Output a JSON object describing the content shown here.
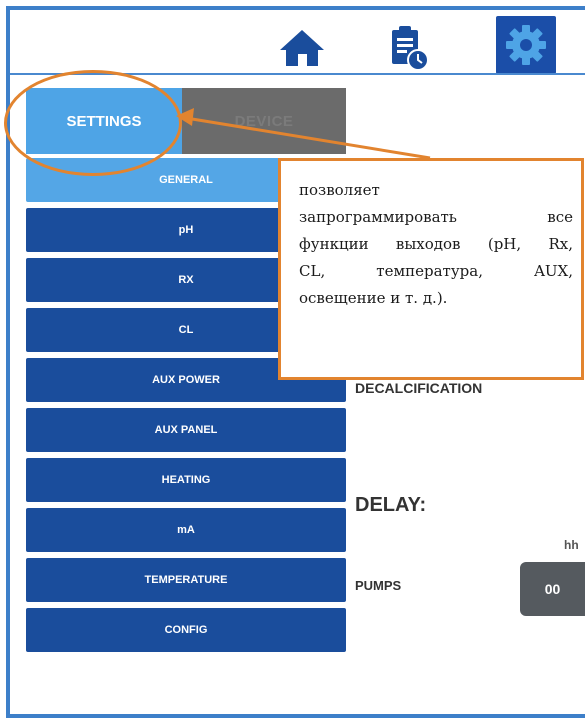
{
  "toolbar": {
    "home_icon": "home-icon",
    "report_icon": "clipboard-clock-icon",
    "settings_icon": "gear-icon"
  },
  "tabs": [
    {
      "label": "SETTINGS",
      "active": true
    },
    {
      "label": "DEVICE",
      "active": false
    }
  ],
  "menu": {
    "items": [
      {
        "label": "GENERAL",
        "active": true
      },
      {
        "label": "pH",
        "active": false
      },
      {
        "label": "RX",
        "active": false
      },
      {
        "label": "CL",
        "active": false
      },
      {
        "label": "AUX POWER",
        "active": false
      },
      {
        "label": "AUX PANEL",
        "active": false
      },
      {
        "label": "HEATING",
        "active": false
      },
      {
        "label": "mA",
        "active": false
      },
      {
        "label": "TEMPERATURE",
        "active": false
      },
      {
        "label": "CONFIG",
        "active": false
      }
    ]
  },
  "callout": {
    "line1": "позволяет",
    "line2": "запрограммировать все",
    "line3": "функции выходов (pH, Rx,",
    "line4": "CL, температура, AUX,",
    "line5": "освещение и т. д.)."
  },
  "content": {
    "decalcification_label": "DECALCIFICATION",
    "delay_label": "DELAY:",
    "hh_label": "hh",
    "pumps_label": "PUMPS",
    "pumps_value": "00"
  },
  "colors": {
    "accent": "#1a4d9c",
    "active_tab": "#4ea4e6",
    "annotation": "#e2842f"
  }
}
